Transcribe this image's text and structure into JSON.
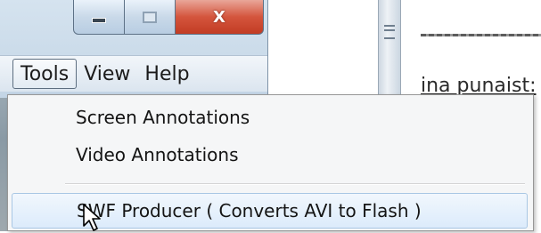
{
  "menubar": {
    "items": [
      {
        "label": "Tools",
        "active": true
      },
      {
        "label": "View"
      },
      {
        "label": "Help"
      }
    ]
  },
  "caption_buttons": {
    "minimize_icon": "minimize-icon",
    "maximize_icon": "maximize-icon",
    "close_icon": "close-icon",
    "close_glyph": "X"
  },
  "background": {
    "partial_text": "ina punaist:"
  },
  "dropdown": {
    "items": [
      {
        "label": "Screen Annotations"
      },
      {
        "label": "Video Annotations"
      },
      {
        "label": "SWF Producer ( Converts AVI to Flash )",
        "highlighted": true
      }
    ]
  },
  "colors": {
    "highlight_bg": "#dcebfb",
    "highlight_border": "#a9c7e4",
    "close_button": "#c23c24"
  }
}
